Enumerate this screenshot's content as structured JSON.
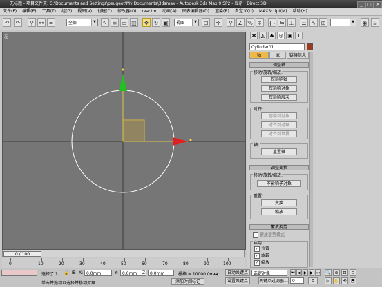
{
  "title": "无标题    - 项目文件夹: C:\\Documents and Settings\\peugeot\\My Documents\\3dsmax    - Autodesk 3ds Max 9 SP2    - 显示 : Direct 3D",
  "menu": [
    "文件(F)",
    "编辑(E)",
    "工具(T)",
    "组(G)",
    "视图(V)",
    "创建(C)",
    "修改器(O)",
    "reactor",
    "动画(A)",
    "图表编辑器(D)",
    "渲染(R)",
    "自定义(U)",
    "MAXScript(M)",
    "帮助(H)"
  ],
  "toolbar": {
    "selection_filter": "全部",
    "ref_coord": "视图"
  },
  "viewport": {
    "label": "左"
  },
  "command_panel": {
    "object_name": "Cylinder01",
    "object_color": "#a0391a",
    "subtabs": [
      "轴",
      "IK",
      "链接信息"
    ],
    "rollout_adjust_pivot": "调整轴",
    "group_move_rotate_scale": "移动/旋转/缩放:",
    "btn_affect_pivot_only": "仅影响轴",
    "btn_affect_object_only": "仅影响对象",
    "btn_affect_hierarchy_only": "仅影响层次",
    "group_align": "对齐:",
    "btn_center_to_object": "居中到对象",
    "btn_align_to_object": "对齐到对象",
    "btn_align_to_world": "对齐到世界",
    "group_pivot": "轴:",
    "btn_reset_pivot": "重置轴",
    "rollout_adjust_transform": "调整变换",
    "group_move_rotate_scale_2": "移动/旋转/缩放:",
    "btn_dont_affect_children": "不影响子对象",
    "group_reset": "重置:",
    "btn_transform": "变换",
    "btn_scale": "缩放",
    "rollout_skin_pose": "蒙皮姿势",
    "chk_skin_pose_mode": "蒙皮姿势模式",
    "group_enabled": "启用",
    "chk_position": "位置",
    "chk_rotation": "旋转",
    "chk_scale": "缩放"
  },
  "timeline": {
    "slider_label": "0 / 100"
  },
  "ruler_ticks": [
    "0",
    "10",
    "20",
    "30",
    "40",
    "50",
    "60",
    "70",
    "80",
    "90",
    "100"
  ],
  "status": {
    "selected_text": "选择了 1",
    "x_label": "X:",
    "x_value": "0.0mm",
    "y_label": "Y:",
    "y_value": "0.0mm",
    "z_label": "Z:",
    "z_value": "0.0mm",
    "grid_text": "栅格 = 10000.0mm",
    "auto_key": "自动关键点",
    "set_key": "设置关键点",
    "selected_object": "选定对象",
    "key_filters": "关键点过滤器...",
    "prompt": "单击并拖动以选择并移动对象",
    "add_time_tag": "添加时间标记",
    "frame_value": "0"
  }
}
